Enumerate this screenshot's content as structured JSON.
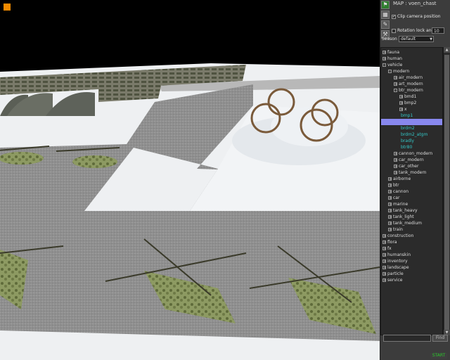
{
  "panel": {
    "map_label": "MAP : voen_chast",
    "clip_camera": {
      "label": "Clip camera position",
      "checked": true
    },
    "rotation_lock": {
      "label": "Rotation lock angle :",
      "checked": false,
      "value": "10"
    },
    "season": {
      "label": "Season",
      "value": "default"
    },
    "tools": [
      {
        "icon": "green-flag-icon"
      },
      {
        "icon": "grid-icon"
      },
      {
        "icon": "pencil-icon"
      },
      {
        "icon": "wrench-icon"
      }
    ],
    "tree": [
      {
        "label": "fauna",
        "level": 0,
        "toggle": "+"
      },
      {
        "label": "human",
        "level": 0,
        "toggle": "+"
      },
      {
        "label": "vehicle",
        "level": 0,
        "toggle": "-"
      },
      {
        "label": "modern",
        "level": 1,
        "toggle": "-"
      },
      {
        "label": "air_modern",
        "level": 2,
        "toggle": "+"
      },
      {
        "label": "art_modern",
        "level": 2,
        "toggle": "+"
      },
      {
        "label": "btr_modern",
        "level": 2,
        "toggle": "-"
      },
      {
        "label": "bmd1",
        "level": 3,
        "toggle": "+"
      },
      {
        "label": "bmp2",
        "level": 3,
        "toggle": "+"
      },
      {
        "label": "x",
        "level": 3,
        "toggle": "+"
      },
      {
        "label": "bmp1",
        "level": 3,
        "toggle": "",
        "leaf": true
      },
      {
        "label": "",
        "level": 3,
        "toggle": "",
        "leaf": true,
        "selected": true
      },
      {
        "label": "brdm2",
        "level": 3,
        "toggle": "",
        "leaf": true
      },
      {
        "label": "brdm2_atgm",
        "level": 3,
        "toggle": "",
        "leaf": true
      },
      {
        "label": "bradly",
        "level": 3,
        "toggle": "",
        "leaf": true
      },
      {
        "label": "btr80",
        "level": 3,
        "toggle": "",
        "leaf": true
      },
      {
        "label": "cannon_modern",
        "level": 2,
        "toggle": "+"
      },
      {
        "label": "car_modern",
        "level": 2,
        "toggle": "+"
      },
      {
        "label": "car_other",
        "level": 2,
        "toggle": "+"
      },
      {
        "label": "tank_modern",
        "level": 2,
        "toggle": "+"
      },
      {
        "label": "airborne",
        "level": 1,
        "toggle": "+"
      },
      {
        "label": "btr",
        "level": 1,
        "toggle": "+"
      },
      {
        "label": "cannon",
        "level": 1,
        "toggle": "+"
      },
      {
        "label": "car",
        "level": 1,
        "toggle": "+"
      },
      {
        "label": "marine",
        "level": 1,
        "toggle": "+"
      },
      {
        "label": "tank_heavy",
        "level": 1,
        "toggle": "+"
      },
      {
        "label": "tank_light",
        "level": 1,
        "toggle": "+"
      },
      {
        "label": "tank_medium",
        "level": 1,
        "toggle": "+"
      },
      {
        "label": "train",
        "level": 1,
        "toggle": "+"
      },
      {
        "label": "construction",
        "level": 0,
        "toggle": "+"
      },
      {
        "label": "flora",
        "level": 0,
        "toggle": "+"
      },
      {
        "label": "fx",
        "level": 0,
        "toggle": "+"
      },
      {
        "label": "humanskin",
        "level": 0,
        "toggle": "+"
      },
      {
        "label": "inventory",
        "level": 0,
        "toggle": "+"
      },
      {
        "label": "landscape",
        "level": 0,
        "toggle": "+"
      },
      {
        "label": "particle",
        "level": 0,
        "toggle": "+"
      },
      {
        "label": "service",
        "level": 0,
        "toggle": "+"
      }
    ],
    "find_button": "Find",
    "start_button": "START"
  }
}
